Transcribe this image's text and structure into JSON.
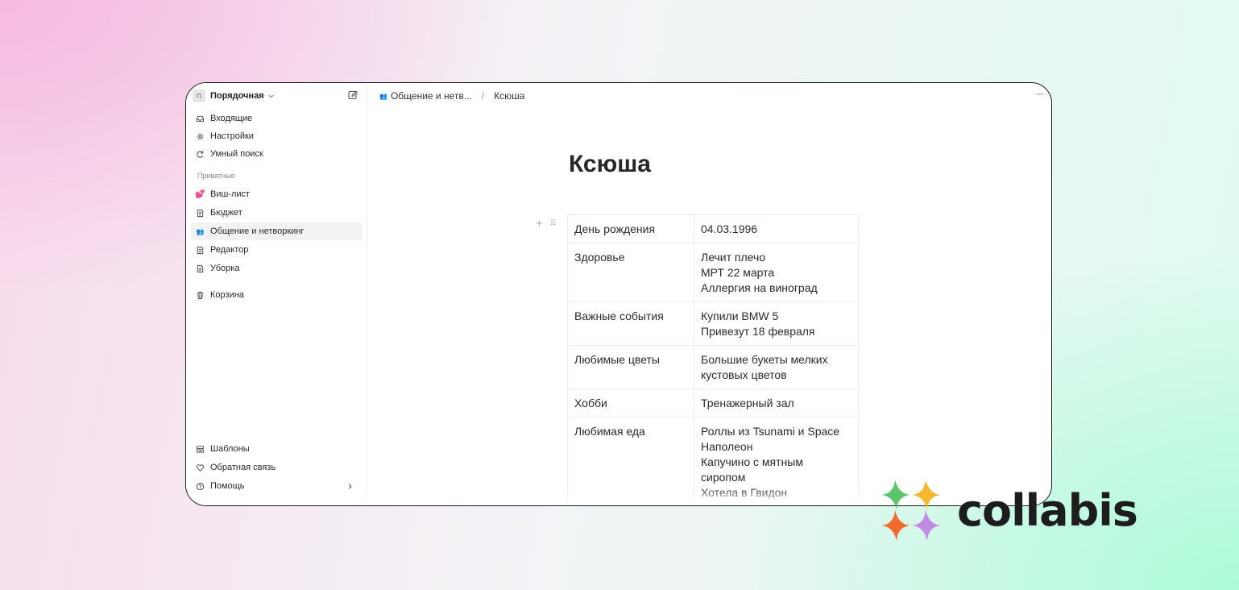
{
  "workspace": {
    "avatar": "П",
    "name": "Порядочная"
  },
  "sidebar": {
    "top": [
      {
        "label": "Входящие",
        "icon": "inbox-icon"
      },
      {
        "label": "Настройки",
        "icon": "gear-icon"
      },
      {
        "label": "Умный поиск",
        "icon": "smart-search-icon"
      }
    ],
    "private_label": "Приватные",
    "private": [
      {
        "label": "Виш-лист",
        "icon": "💕"
      },
      {
        "label": "Бюджет",
        "icon": "document-icon"
      },
      {
        "label": "Общение и нетворкинг",
        "icon": "👥"
      },
      {
        "label": "Редактор",
        "icon": "document-icon"
      },
      {
        "label": "Уборка",
        "icon": "document-icon"
      }
    ],
    "trash": {
      "label": "Корзина",
      "icon": "trash-icon"
    },
    "bottom": [
      {
        "label": "Шаблоны",
        "icon": "templates-icon"
      },
      {
        "label": "Обратная связь",
        "icon": "heart-icon"
      },
      {
        "label": "Помощь",
        "icon": "help-icon"
      }
    ]
  },
  "breadcrumb": {
    "parent_icon": "👥",
    "parent": "Общение и нетв...",
    "separator": "/",
    "current": "Ксюша"
  },
  "more_label": "···",
  "page": {
    "title": "Ксюша",
    "properties": [
      {
        "key": "День рождения",
        "lines": [
          "04.03.1996"
        ]
      },
      {
        "key": "Здоровье",
        "lines": [
          "Лечит плечо",
          "МРТ 22 марта",
          "Аллергия на виноград"
        ]
      },
      {
        "key": "Важные события",
        "lines": [
          "Купили BMW 5",
          "Привезут 18 февраля"
        ]
      },
      {
        "key": "Любимые цветы",
        "lines": [
          "Большие букеты мелких",
          "кустовых цветов"
        ]
      },
      {
        "key": "Хобби",
        "lines": [
          "Тренажерный зал"
        ]
      },
      {
        "key": "Любимая еда",
        "lines": [
          "Роллы из Tsunami и Space",
          "Наполеон",
          "Капучино с мятным",
          "сиропом",
          "Хотела в Гвидон"
        ]
      }
    ]
  },
  "brand": {
    "name": "collabis",
    "colors": [
      "#5cc46a",
      "#f5b82e",
      "#f26a2e",
      "#c489e0"
    ]
  }
}
